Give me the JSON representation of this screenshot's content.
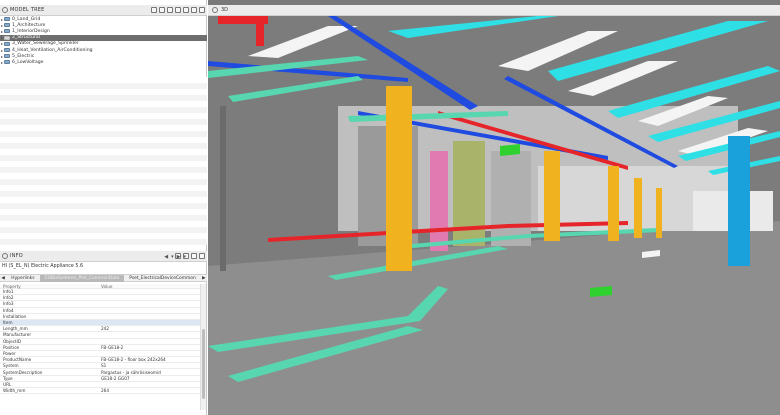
{
  "model_tree": {
    "title": "MODEL TREE",
    "items": [
      {
        "label": "0_Land_Grid",
        "selected": false
      },
      {
        "label": "1_Architecture",
        "selected": false
      },
      {
        "label": "1_InteriorDesign",
        "selected": false
      },
      {
        "label": "2_Structural",
        "selected": true
      },
      {
        "label": "3_Water_Sewerage_Sprinkler",
        "selected": false
      },
      {
        "label": "4_Heat_Ventilation_AirConditioning",
        "selected": false
      },
      {
        "label": "5_Electric",
        "selected": false
      },
      {
        "label": "6_LowVoltage",
        "selected": false
      }
    ]
  },
  "info": {
    "title": "INFO",
    "nav": {
      "back": "◀",
      "dropdown": "▾",
      "forward": "▶",
      "forward_dropdown": "▾"
    },
    "object_title": "HI (S_EL_N) Electric Appliance 5.6",
    "tabs": {
      "prev": "◀",
      "next": "▶",
      "items": [
        {
          "label": "Hyperlinks",
          "active": false
        },
        {
          "label": "COBIeSeletron_Plot_CommonData",
          "active": true
        },
        {
          "label": "Pset_ElectricalDeviceCommon",
          "active": false
        }
      ]
    },
    "properties": {
      "headers": {
        "key": "Property",
        "value": "Value"
      },
      "rows": [
        {
          "key": "Info1",
          "value": ""
        },
        {
          "key": "Info2",
          "value": ""
        },
        {
          "key": "Info3",
          "value": ""
        },
        {
          "key": "Info4",
          "value": ""
        },
        {
          "key": "Installation",
          "value": ""
        },
        {
          "key": "Item",
          "value": "",
          "selected": true
        },
        {
          "key": "Length_mm",
          "value": "242"
        },
        {
          "key": "Manufacturer",
          "value": ""
        },
        {
          "key": "ObjectID",
          "value": ""
        },
        {
          "key": "Position",
          "value": "FB-GE18-2"
        },
        {
          "key": "Power",
          "value": ""
        },
        {
          "key": "ProductName",
          "value": "FB-GE18-2 - floor box 242x264"
        },
        {
          "key": "System",
          "value": "S1"
        },
        {
          "key": "SystemDescription",
          "value": "Pargastus - ja sährösiseomid"
        },
        {
          "key": "Type",
          "value": "GE18-2 GG07"
        },
        {
          "key": "URL",
          "value": ""
        },
        {
          "key": "Width_mm",
          "value": "264"
        }
      ]
    }
  },
  "viewport": {
    "title": "3D",
    "colors": {
      "ceiling_bg": "#7c7c7c",
      "floor": "#8e8e8e",
      "duct_cyan": "#2ee0e6",
      "pipe_blue": "#1f4be0",
      "pipe_red": "#e6252a",
      "column_yellow": "#f1b21f",
      "column_blue": "#1aa0da",
      "tray_green": "#58d6b0",
      "wall_pink": "#e07ab0",
      "wall_olive": "#a9b36a",
      "wall_grey": "#bfbfbf",
      "light_white": "#f4f4f4",
      "box_green": "#2fd12f"
    }
  }
}
